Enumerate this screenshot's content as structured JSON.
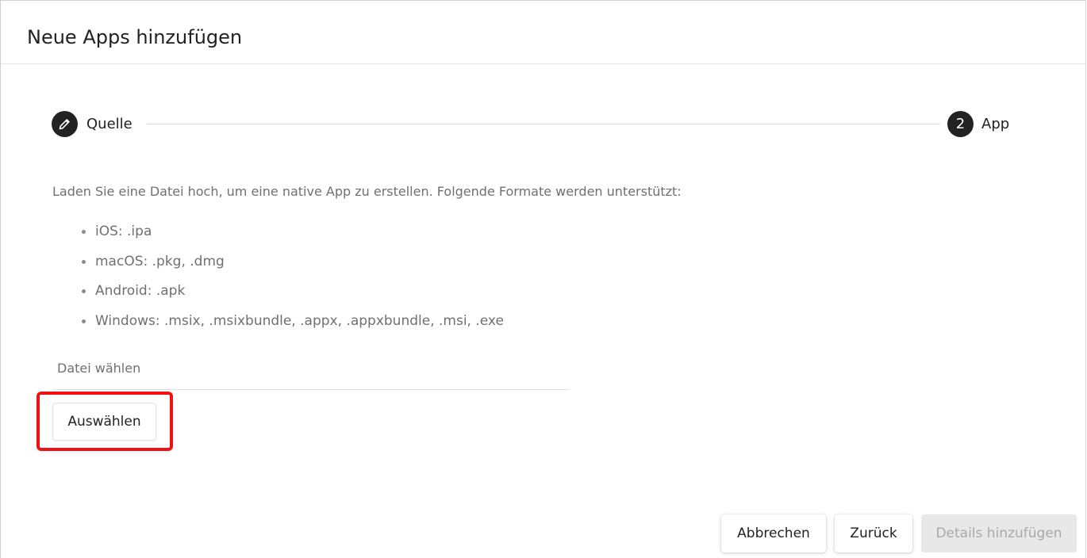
{
  "dialog": {
    "title": "Neue Apps hinzufügen"
  },
  "stepper": {
    "steps": [
      {
        "label": "Quelle",
        "icon": "pencil-icon",
        "state": "active"
      },
      {
        "label": "App",
        "number": "2",
        "state": "pending"
      }
    ]
  },
  "content": {
    "intro": "Laden Sie eine Datei hoch, um eine native App zu erstellen. Folgende Formate werden unterstützt:",
    "formats": [
      "iOS: .ipa",
      "macOS: .pkg, .dmg",
      "Android: .apk",
      "Windows: .msix, .msixbundle, .appx, .appxbundle, .msi, .exe"
    ],
    "file_label": "Datei wählen",
    "choose_label": "Auswählen"
  },
  "footer": {
    "cancel_label": "Abbrechen",
    "back_label": "Zurück",
    "details_label": "Details hinzufügen"
  },
  "colors": {
    "step_active": "#222222",
    "highlight": "#f21111",
    "disabled_bg": "#e8e8e8",
    "disabled_text": "#a9a9a9"
  }
}
